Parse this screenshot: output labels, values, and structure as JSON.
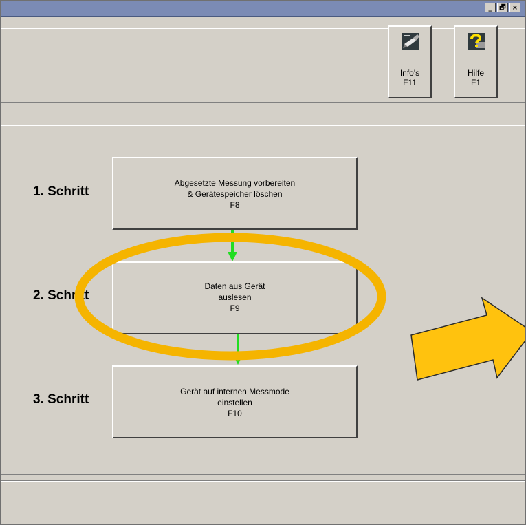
{
  "window": {
    "controls": {
      "minimize": "_",
      "restore": "🗗",
      "close": "×"
    }
  },
  "toolbar": {
    "info_button": {
      "label": "Info's",
      "key": "F11",
      "icon": "clipboard-pencil-icon"
    },
    "help_button": {
      "label": "Hilfe",
      "key": "F1",
      "icon": "question-book-icon"
    }
  },
  "steps": [
    {
      "label": "1. Schritt",
      "button": {
        "line1": "Abgesetzte Messung vorbereiten",
        "line2": "& Gerätespeicher löschen",
        "key": "F8"
      }
    },
    {
      "label": "2. Schritt",
      "button": {
        "line1": "Daten aus Gerät",
        "line2": "auslesen",
        "key": "F9"
      }
    },
    {
      "label": "3. Schritt",
      "button": {
        "line1": "Gerät auf internen Messmode",
        "line2": "einstellen",
        "key": "F10"
      }
    }
  ],
  "colors": {
    "connector_arrow": "#22dd22",
    "highlight_ellipse": "#f5b400",
    "callout_arrow": "#ffc20e"
  }
}
